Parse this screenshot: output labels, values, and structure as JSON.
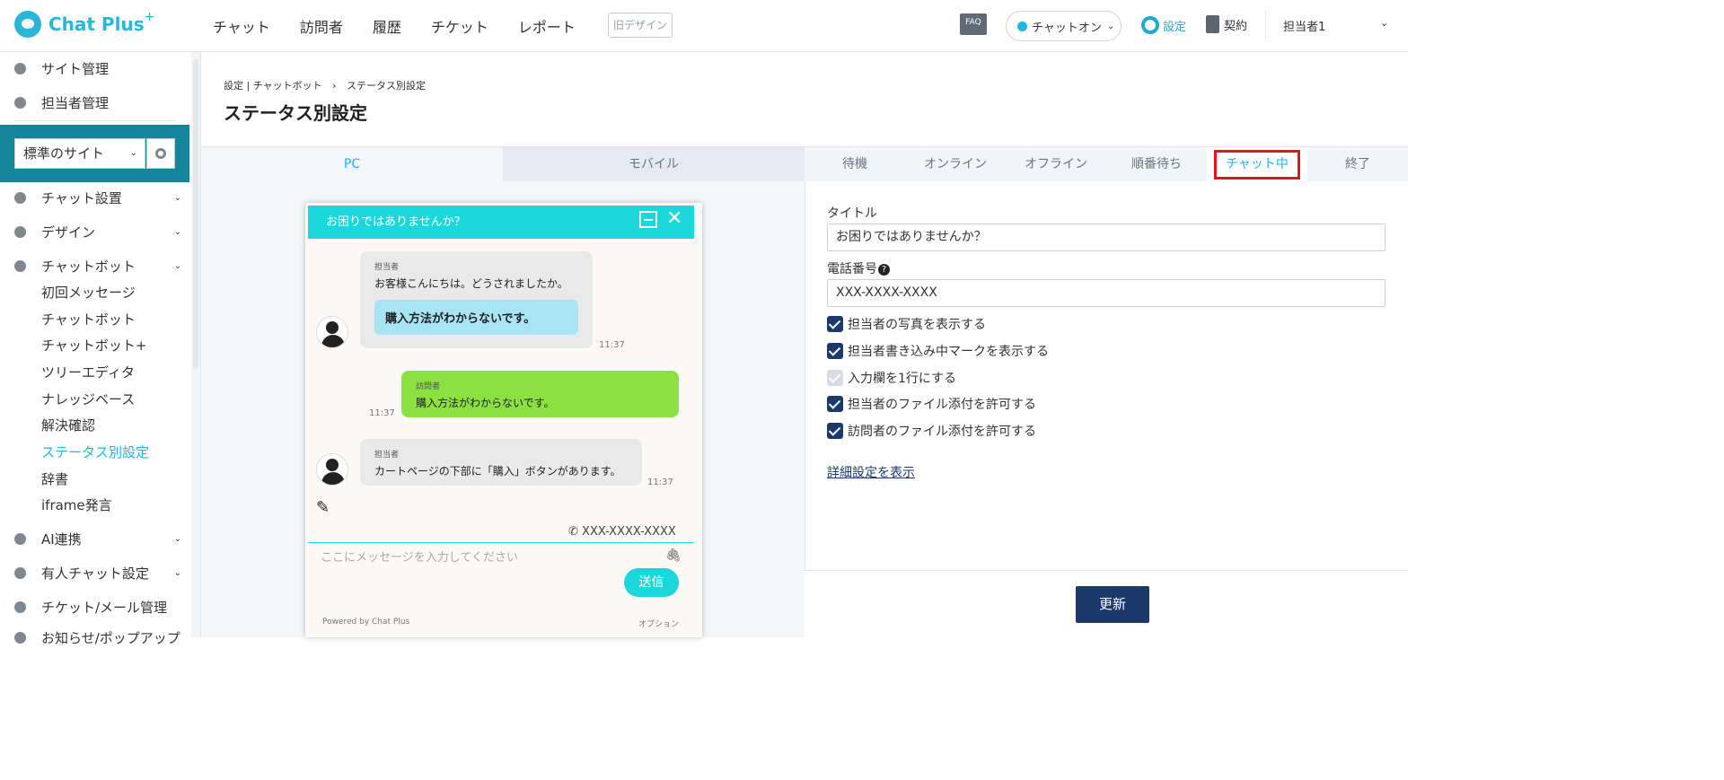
{
  "app": {
    "logo_text": "Chat Plus",
    "logo_sup": "+"
  },
  "nav": {
    "items": [
      "チャット",
      "訪問者",
      "履歴",
      "チケット",
      "レポート"
    ],
    "old_design": "旧デザイン"
  },
  "header_right": {
    "faq": "FAQ",
    "chat_status": "チャットオン",
    "settings": "設定",
    "contract": "契約",
    "user": "担当者1"
  },
  "sidebar": {
    "top_items": [
      {
        "label": "サイト管理",
        "icon": "gear-icon"
      },
      {
        "label": "担当者管理",
        "icon": "user-icon"
      }
    ],
    "site_select": "標準のサイト",
    "sections": [
      {
        "label": "チャット設置",
        "icon": "tools-icon"
      },
      {
        "label": "デザイン",
        "icon": "palette-icon"
      },
      {
        "label": "チャットボット",
        "icon": "chat-icon"
      }
    ],
    "bot_sub": [
      "初回メッセージ",
      "チャットボット",
      "チャットボット+",
      "ツリーエディタ",
      "ナレッジベース",
      "解決確認",
      "ステータス別設定",
      "辞書",
      "iframe発言"
    ],
    "bot_sub_active_index": 6,
    "bottom_sections": [
      {
        "label": "AI連携",
        "icon": "ai-icon"
      },
      {
        "label": "有人チャット設定",
        "icon": "headset-icon"
      },
      {
        "label": "チケット/メール管理",
        "icon": "ticket-icon"
      },
      {
        "label": "お知らせ/ポップアップ",
        "icon": "bell-icon"
      }
    ]
  },
  "page": {
    "breadcrumb_root": "設定 | チャットボット",
    "breadcrumb_sep": "›",
    "breadcrumb_current": "ステータス別設定",
    "title": "ステータス別設定"
  },
  "device_tabs": {
    "pc": "PC",
    "mobile": "モバイル"
  },
  "status_tabs": {
    "items": [
      "待機",
      "オンライン",
      "オフライン",
      "順番待ち",
      "チャット中",
      "終了"
    ],
    "active_index": 4
  },
  "preview": {
    "title": "お困りではありませんか？",
    "msg1_name": "担当者",
    "msg1_text": "お客様こんにちは。どうされましたか。",
    "msg1_option": "購入方法がわからないです。",
    "msg1_time": "11:37",
    "msg2_name": "訪問者",
    "msg2_text": "購入方法がわからないです。",
    "msg2_time": "11:37",
    "msg3_name": "担当者",
    "msg3_text": "カートページの下部に「購入」ボタンがあります。",
    "msg3_time": "11:37",
    "phone": "XXX-XXXX-XXXX",
    "input_placeholder": "ここにメッセージを入力してください",
    "send": "送信",
    "powered": "Powered by Chat Plus",
    "option": "オプション"
  },
  "form": {
    "title_label": "タイトル",
    "title_value": "お困りではありませんか？",
    "phone_label": "電話番号",
    "phone_value": "XXX-XXXX-XXXX",
    "checkboxes": [
      {
        "label": "担当者の写真を表示する",
        "checked": true
      },
      {
        "label": "担当者書き込み中マークを表示する",
        "checked": true
      },
      {
        "label": "入力欄を1行にする",
        "checked": true,
        "disabled": true
      },
      {
        "label": "担当者のファイル添付を許可する",
        "checked": true
      },
      {
        "label": "訪問者のファイル添付を許可する",
        "checked": true
      }
    ],
    "detail_link": "詳細設定を表示",
    "update_button": "更新"
  },
  "colors": {
    "accent": "#1fb6e4",
    "site_box": "#14869c",
    "primary_button": "#1b3a6b",
    "preview_header": "#1ad7db",
    "visitor_bubble": "#8be042",
    "highlight_box": "#e3141d"
  }
}
